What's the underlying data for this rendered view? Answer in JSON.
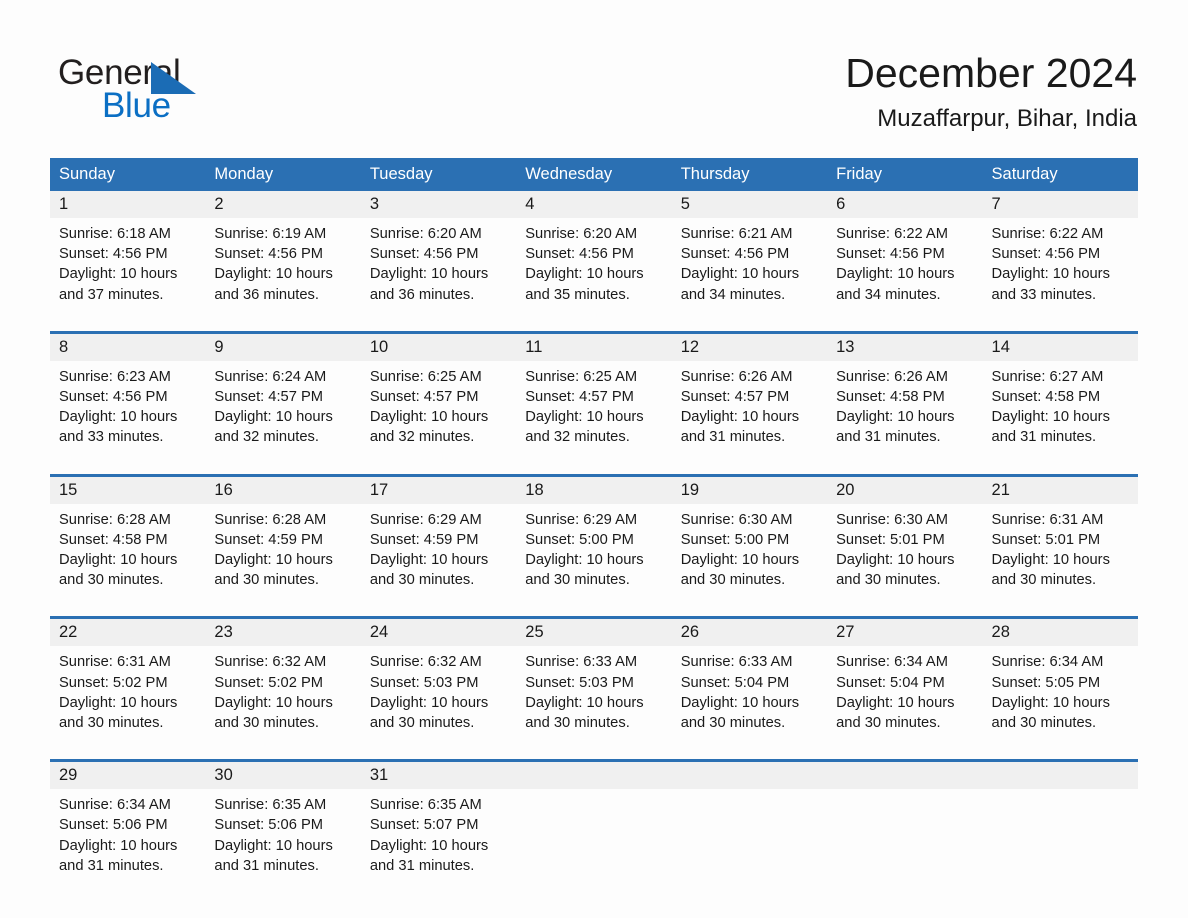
{
  "brand": {
    "name_part1": "General",
    "name_part2": "Blue",
    "triangle_color": "#1b6cb5",
    "blue_text_color": "#0b6fc4"
  },
  "header": {
    "title": "December 2024",
    "location": "Muzaffarpur, Bihar, India"
  },
  "theme": {
    "header_blue": "#2b70b3",
    "daynum_band": "#f0f0f0",
    "page_bg": "#fdfdfd",
    "text": "#1a1a1a"
  },
  "weekday_headers": [
    "Sunday",
    "Monday",
    "Tuesday",
    "Wednesday",
    "Thursday",
    "Friday",
    "Saturday"
  ],
  "weeks": [
    [
      {
        "day": "1",
        "sunrise": "Sunrise: 6:18 AM",
        "sunset": "Sunset: 4:56 PM",
        "daylight_l1": "Daylight: 10 hours",
        "daylight_l2": "and 37 minutes."
      },
      {
        "day": "2",
        "sunrise": "Sunrise: 6:19 AM",
        "sunset": "Sunset: 4:56 PM",
        "daylight_l1": "Daylight: 10 hours",
        "daylight_l2": "and 36 minutes."
      },
      {
        "day": "3",
        "sunrise": "Sunrise: 6:20 AM",
        "sunset": "Sunset: 4:56 PM",
        "daylight_l1": "Daylight: 10 hours",
        "daylight_l2": "and 36 minutes."
      },
      {
        "day": "4",
        "sunrise": "Sunrise: 6:20 AM",
        "sunset": "Sunset: 4:56 PM",
        "daylight_l1": "Daylight: 10 hours",
        "daylight_l2": "and 35 minutes."
      },
      {
        "day": "5",
        "sunrise": "Sunrise: 6:21 AM",
        "sunset": "Sunset: 4:56 PM",
        "daylight_l1": "Daylight: 10 hours",
        "daylight_l2": "and 34 minutes."
      },
      {
        "day": "6",
        "sunrise": "Sunrise: 6:22 AM",
        "sunset": "Sunset: 4:56 PM",
        "daylight_l1": "Daylight: 10 hours",
        "daylight_l2": "and 34 minutes."
      },
      {
        "day": "7",
        "sunrise": "Sunrise: 6:22 AM",
        "sunset": "Sunset: 4:56 PM",
        "daylight_l1": "Daylight: 10 hours",
        "daylight_l2": "and 33 minutes."
      }
    ],
    [
      {
        "day": "8",
        "sunrise": "Sunrise: 6:23 AM",
        "sunset": "Sunset: 4:56 PM",
        "daylight_l1": "Daylight: 10 hours",
        "daylight_l2": "and 33 minutes."
      },
      {
        "day": "9",
        "sunrise": "Sunrise: 6:24 AM",
        "sunset": "Sunset: 4:57 PM",
        "daylight_l1": "Daylight: 10 hours",
        "daylight_l2": "and 32 minutes."
      },
      {
        "day": "10",
        "sunrise": "Sunrise: 6:25 AM",
        "sunset": "Sunset: 4:57 PM",
        "daylight_l1": "Daylight: 10 hours",
        "daylight_l2": "and 32 minutes."
      },
      {
        "day": "11",
        "sunrise": "Sunrise: 6:25 AM",
        "sunset": "Sunset: 4:57 PM",
        "daylight_l1": "Daylight: 10 hours",
        "daylight_l2": "and 32 minutes."
      },
      {
        "day": "12",
        "sunrise": "Sunrise: 6:26 AM",
        "sunset": "Sunset: 4:57 PM",
        "daylight_l1": "Daylight: 10 hours",
        "daylight_l2": "and 31 minutes."
      },
      {
        "day": "13",
        "sunrise": "Sunrise: 6:26 AM",
        "sunset": "Sunset: 4:58 PM",
        "daylight_l1": "Daylight: 10 hours",
        "daylight_l2": "and 31 minutes."
      },
      {
        "day": "14",
        "sunrise": "Sunrise: 6:27 AM",
        "sunset": "Sunset: 4:58 PM",
        "daylight_l1": "Daylight: 10 hours",
        "daylight_l2": "and 31 minutes."
      }
    ],
    [
      {
        "day": "15",
        "sunrise": "Sunrise: 6:28 AM",
        "sunset": "Sunset: 4:58 PM",
        "daylight_l1": "Daylight: 10 hours",
        "daylight_l2": "and 30 minutes."
      },
      {
        "day": "16",
        "sunrise": "Sunrise: 6:28 AM",
        "sunset": "Sunset: 4:59 PM",
        "daylight_l1": "Daylight: 10 hours",
        "daylight_l2": "and 30 minutes."
      },
      {
        "day": "17",
        "sunrise": "Sunrise: 6:29 AM",
        "sunset": "Sunset: 4:59 PM",
        "daylight_l1": "Daylight: 10 hours",
        "daylight_l2": "and 30 minutes."
      },
      {
        "day": "18",
        "sunrise": "Sunrise: 6:29 AM",
        "sunset": "Sunset: 5:00 PM",
        "daylight_l1": "Daylight: 10 hours",
        "daylight_l2": "and 30 minutes."
      },
      {
        "day": "19",
        "sunrise": "Sunrise: 6:30 AM",
        "sunset": "Sunset: 5:00 PM",
        "daylight_l1": "Daylight: 10 hours",
        "daylight_l2": "and 30 minutes."
      },
      {
        "day": "20",
        "sunrise": "Sunrise: 6:30 AM",
        "sunset": "Sunset: 5:01 PM",
        "daylight_l1": "Daylight: 10 hours",
        "daylight_l2": "and 30 minutes."
      },
      {
        "day": "21",
        "sunrise": "Sunrise: 6:31 AM",
        "sunset": "Sunset: 5:01 PM",
        "daylight_l1": "Daylight: 10 hours",
        "daylight_l2": "and 30 minutes."
      }
    ],
    [
      {
        "day": "22",
        "sunrise": "Sunrise: 6:31 AM",
        "sunset": "Sunset: 5:02 PM",
        "daylight_l1": "Daylight: 10 hours",
        "daylight_l2": "and 30 minutes."
      },
      {
        "day": "23",
        "sunrise": "Sunrise: 6:32 AM",
        "sunset": "Sunset: 5:02 PM",
        "daylight_l1": "Daylight: 10 hours",
        "daylight_l2": "and 30 minutes."
      },
      {
        "day": "24",
        "sunrise": "Sunrise: 6:32 AM",
        "sunset": "Sunset: 5:03 PM",
        "daylight_l1": "Daylight: 10 hours",
        "daylight_l2": "and 30 minutes."
      },
      {
        "day": "25",
        "sunrise": "Sunrise: 6:33 AM",
        "sunset": "Sunset: 5:03 PM",
        "daylight_l1": "Daylight: 10 hours",
        "daylight_l2": "and 30 minutes."
      },
      {
        "day": "26",
        "sunrise": "Sunrise: 6:33 AM",
        "sunset": "Sunset: 5:04 PM",
        "daylight_l1": "Daylight: 10 hours",
        "daylight_l2": "and 30 minutes."
      },
      {
        "day": "27",
        "sunrise": "Sunrise: 6:34 AM",
        "sunset": "Sunset: 5:04 PM",
        "daylight_l1": "Daylight: 10 hours",
        "daylight_l2": "and 30 minutes."
      },
      {
        "day": "28",
        "sunrise": "Sunrise: 6:34 AM",
        "sunset": "Sunset: 5:05 PM",
        "daylight_l1": "Daylight: 10 hours",
        "daylight_l2": "and 30 minutes."
      }
    ],
    [
      {
        "day": "29",
        "sunrise": "Sunrise: 6:34 AM",
        "sunset": "Sunset: 5:06 PM",
        "daylight_l1": "Daylight: 10 hours",
        "daylight_l2": "and 31 minutes."
      },
      {
        "day": "30",
        "sunrise": "Sunrise: 6:35 AM",
        "sunset": "Sunset: 5:06 PM",
        "daylight_l1": "Daylight: 10 hours",
        "daylight_l2": "and 31 minutes."
      },
      {
        "day": "31",
        "sunrise": "Sunrise: 6:35 AM",
        "sunset": "Sunset: 5:07 PM",
        "daylight_l1": "Daylight: 10 hours",
        "daylight_l2": "and 31 minutes."
      },
      {
        "day": "",
        "sunrise": "",
        "sunset": "",
        "daylight_l1": "",
        "daylight_l2": ""
      },
      {
        "day": "",
        "sunrise": "",
        "sunset": "",
        "daylight_l1": "",
        "daylight_l2": ""
      },
      {
        "day": "",
        "sunrise": "",
        "sunset": "",
        "daylight_l1": "",
        "daylight_l2": ""
      },
      {
        "day": "",
        "sunrise": "",
        "sunset": "",
        "daylight_l1": "",
        "daylight_l2": ""
      }
    ]
  ]
}
